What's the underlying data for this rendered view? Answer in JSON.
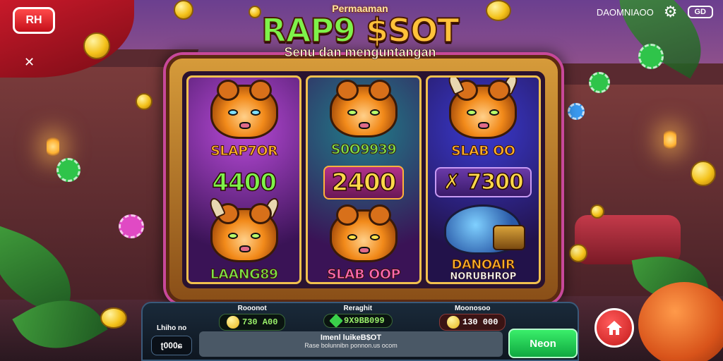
{
  "game": {
    "title_top": "Permaaman",
    "title_main_a": "RAP9 ",
    "title_main_b": "$SOT",
    "title_sub": "Senu dan menguntangan"
  },
  "topbar": {
    "left_button": "RH",
    "side_icon": "✕",
    "username": "DAOMNIAOO",
    "gear_icon": "⚙",
    "badge": "GD"
  },
  "reels": [
    {
      "top_label": "SLAP7OR",
      "big": "4400",
      "bottom_label": "LAANG89"
    },
    {
      "top_label": "S0O9939",
      "big": "2400",
      "bottom_label": "SLAB OOP"
    },
    {
      "top_label": "SLAB OO",
      "big": "✗ 7300",
      "bottom_label": "DANOAIR",
      "bottom_sub": "NORUBHROP"
    }
  ],
  "panel": {
    "stats": [
      {
        "label": "Rooonot",
        "value": "730 A00"
      },
      {
        "label": "Reraghit",
        "value": "9X9BB099"
      },
      {
        "label": "Moonosoo",
        "value": "130 000"
      }
    ],
    "bet_label": "Lhiho no",
    "bet_value": "ʈ000ɕ",
    "message_title": "Imenl luikeB$OT",
    "message_body": "Rase bolunnibn ponnon.us ocom",
    "spin_label": "Neon"
  },
  "home_icon": "home-icon"
}
